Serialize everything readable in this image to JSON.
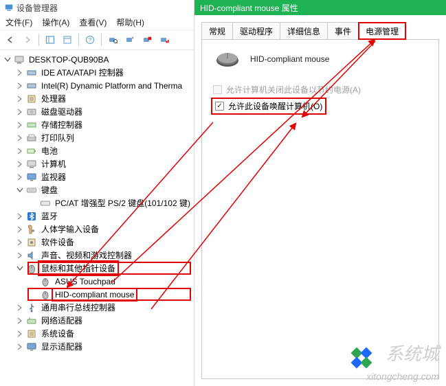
{
  "left": {
    "title": "设备管理器",
    "menu": {
      "file": "文件(F)",
      "action": "操作(A)",
      "view": "查看(V)",
      "help": "帮助(H)"
    },
    "root": "DESKTOP-QUB90BA",
    "nodes": [
      {
        "key": "ide",
        "label": "IDE ATA/ATAPI 控制器",
        "expand": ">"
      },
      {
        "key": "intel",
        "label": "Intel(R) Dynamic Platform and Therma",
        "expand": ">"
      },
      {
        "key": "cpu",
        "label": "处理器",
        "expand": ">"
      },
      {
        "key": "disk",
        "label": "磁盘驱动器",
        "expand": ">"
      },
      {
        "key": "storage",
        "label": "存储控制器",
        "expand": ">"
      },
      {
        "key": "printq",
        "label": "打印队列",
        "expand": ">"
      },
      {
        "key": "battery",
        "label": "电池",
        "expand": ">"
      },
      {
        "key": "computer",
        "label": "计算机",
        "expand": ">"
      },
      {
        "key": "monitor",
        "label": "监视器",
        "expand": ">"
      },
      {
        "key": "keyboard",
        "label": "键盘",
        "expand": "v",
        "children": [
          {
            "key": "kb-ps2",
            "label": "PC/AT 增强型 PS/2 键盘(101/102 键)"
          }
        ]
      },
      {
        "key": "bt",
        "label": "蓝牙",
        "expand": ">"
      },
      {
        "key": "hid",
        "label": "人体学输入设备",
        "expand": ">"
      },
      {
        "key": "sw",
        "label": "软件设备",
        "expand": ">"
      },
      {
        "key": "sound",
        "label": "声音、视频和游戏控制器",
        "expand": ">"
      },
      {
        "key": "mouse",
        "label": "鼠标和其他指针设备",
        "expand": "v",
        "hl": true,
        "children": [
          {
            "key": "mouse-asus",
            "label": "ASUS Touchpad"
          },
          {
            "key": "mouse-hid",
            "label": "HID-compliant mouse",
            "hl": true
          }
        ]
      },
      {
        "key": "usb",
        "label": "通用串行总线控制器",
        "expand": ">"
      },
      {
        "key": "net",
        "label": "网络适配器",
        "expand": ">"
      },
      {
        "key": "sysdev",
        "label": "系统设备",
        "expand": ">"
      },
      {
        "key": "display",
        "label": "显示适配器",
        "expand": ">"
      }
    ]
  },
  "right": {
    "title": "HID-compliant mouse 属性",
    "tabs": {
      "general": "常规",
      "driver": "驱动程序",
      "details": "详细信息",
      "events": "事件",
      "power": "电源管理"
    },
    "device_name": "HID-compliant mouse",
    "opt_power_off": "允许计算机关闭此设备以节约电源(A)",
    "opt_wake": "允许此设备唤醒计算机(O)"
  },
  "watermark": {
    "brand": "系统城",
    "url": "xitongcheng.com"
  }
}
